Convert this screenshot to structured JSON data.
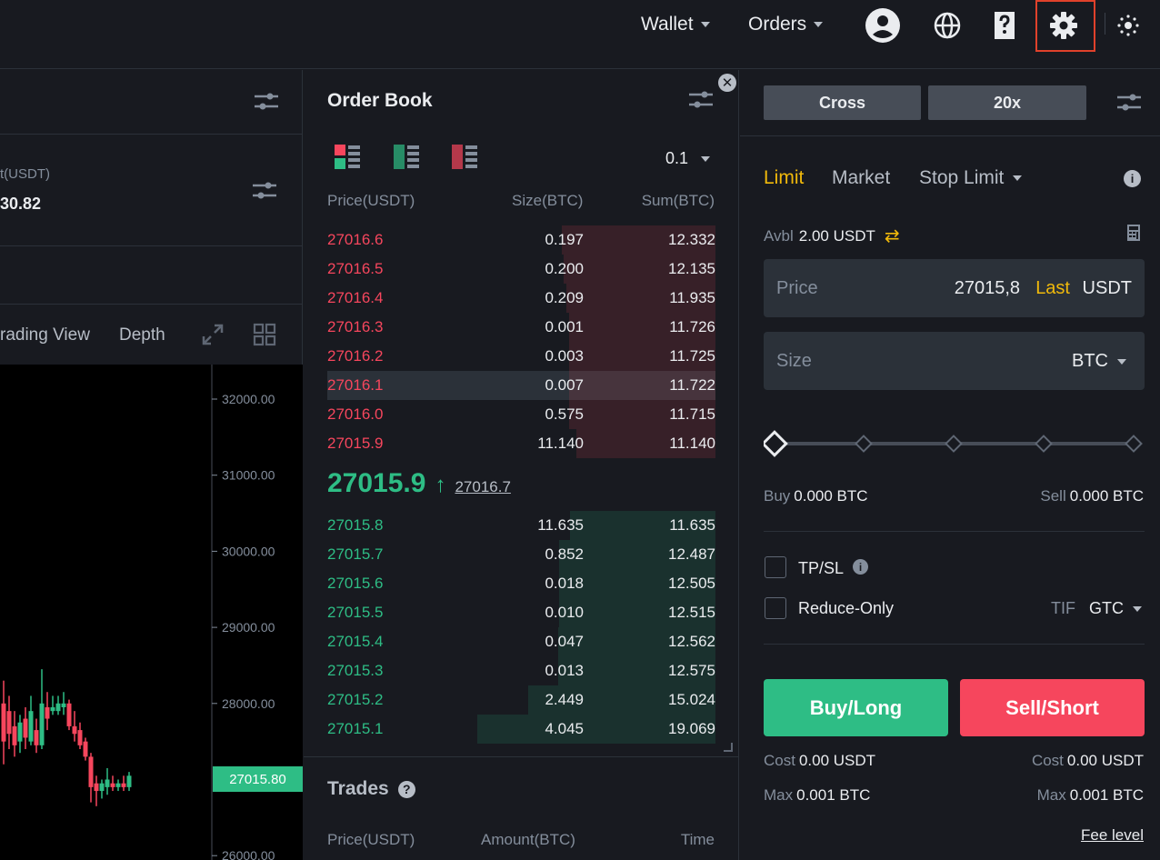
{
  "topbar": {
    "wallet_label": "Wallet",
    "orders_label": "Orders",
    "icons": [
      "user-icon",
      "globe-icon",
      "help-icon",
      "settings-icon",
      "theme-icon"
    ]
  },
  "left": {
    "unit_label": "t(USDT)",
    "unit_value": "30.82",
    "tab_trading_view": "rading View",
    "tab_depth": "Depth",
    "y_axis_ticks": [
      "32000.00",
      "31000.00",
      "30000.00",
      "29000.00",
      "28000.00",
      "26000.00"
    ],
    "last_price_tag": "27015.80"
  },
  "orderbook": {
    "title": "Order Book",
    "precision": "0.1",
    "col_price": "Price(USDT)",
    "col_size": "Size(BTC)",
    "col_sum": "Sum(BTC)",
    "asks": [
      {
        "price": "27016.6",
        "size": "0.197",
        "sum": "12.332",
        "depth": 0.646
      },
      {
        "price": "27016.5",
        "size": "0.200",
        "sum": "12.135",
        "depth": 0.636
      },
      {
        "price": "27016.4",
        "size": "0.209",
        "sum": "11.935",
        "depth": 0.626
      },
      {
        "price": "27016.3",
        "size": "0.001",
        "sum": "11.726",
        "depth": 0.615
      },
      {
        "price": "27016.2",
        "size": "0.003",
        "sum": "11.725",
        "depth": 0.615
      },
      {
        "price": "27016.1",
        "size": "0.007",
        "sum": "11.722",
        "depth": 0.615
      },
      {
        "price": "27016.0",
        "size": "0.575",
        "sum": "11.715",
        "depth": 0.614
      },
      {
        "price": "27015.9",
        "size": "11.140",
        "sum": "11.140",
        "depth": 0.584
      }
    ],
    "last_price": "27015.9",
    "mark_price": "27016.7",
    "bids": [
      {
        "price": "27015.8",
        "size": "11.635",
        "sum": "11.635",
        "depth": 0.61
      },
      {
        "price": "27015.7",
        "size": "0.852",
        "sum": "12.487",
        "depth": 0.655
      },
      {
        "price": "27015.6",
        "size": "0.018",
        "sum": "12.505",
        "depth": 0.656
      },
      {
        "price": "27015.5",
        "size": "0.010",
        "sum": "12.515",
        "depth": 0.656
      },
      {
        "price": "27015.4",
        "size": "0.047",
        "sum": "12.562",
        "depth": 0.659
      },
      {
        "price": "27015.3",
        "size": "0.013",
        "sum": "12.575",
        "depth": 0.659
      },
      {
        "price": "27015.2",
        "size": "2.449",
        "sum": "15.024",
        "depth": 0.788
      },
      {
        "price": "27015.1",
        "size": "4.045",
        "sum": "19.069",
        "depth": 1.0
      }
    ],
    "trades_title": "Trades",
    "trades_col_price": "Price(USDT)",
    "trades_col_amount": "Amount(BTC)",
    "trades_col_time": "Time"
  },
  "order_form": {
    "margin_mode": "Cross",
    "leverage": "20x",
    "tab_limit": "Limit",
    "tab_market": "Market",
    "tab_stop_limit": "Stop Limit",
    "avbl_label": "Avbl",
    "avbl_value": "2.00 USDT",
    "price_label": "Price",
    "price_value": "27015,8",
    "price_last": "Last",
    "price_unit": "USDT",
    "size_label": "Size",
    "size_unit": "BTC",
    "slider_level": 0,
    "buy_label": "Buy",
    "buy_value": "0.000 BTC",
    "sell_label": "Sell",
    "sell_value": "0.000 BTC",
    "tpsl_label": "TP/SL",
    "reduce_only_label": "Reduce-Only",
    "tif_label": "TIF",
    "tif_value": "GTC",
    "buy_button": "Buy/Long",
    "sell_button": "Sell/Short",
    "cost_label": "Cost",
    "buy_cost": "0.00 USDT",
    "sell_cost": "0.00 USDT",
    "max_label": "Max",
    "buy_max": "0.001 BTC",
    "sell_max": "0.001 BTC",
    "fee_level": "Fee level"
  },
  "colors": {
    "up": "#2ebd85",
    "down": "#f6465d",
    "accent": "#f0b90b",
    "highlight": "#e0412b"
  }
}
